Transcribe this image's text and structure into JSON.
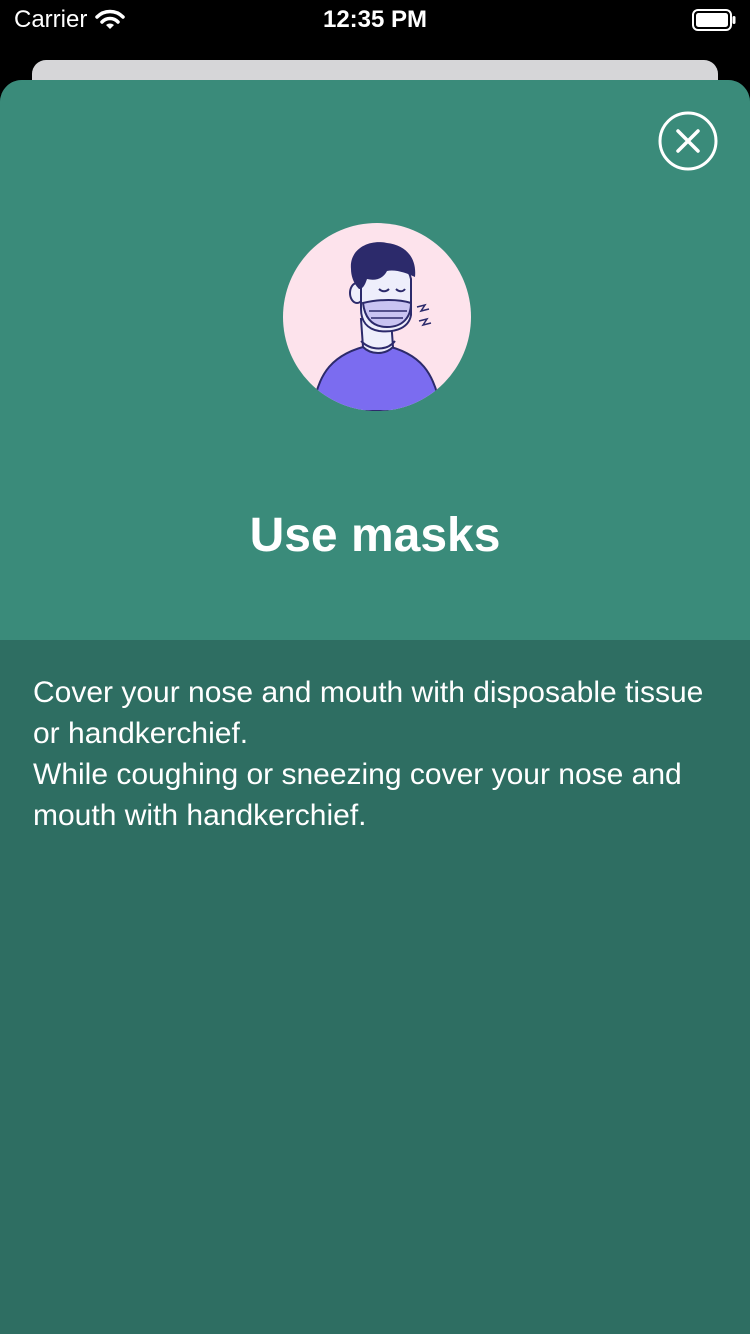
{
  "status_bar": {
    "carrier": "Carrier",
    "time": "12:35 PM",
    "wifi_icon": "wifi-icon",
    "battery_icon": "battery-icon"
  },
  "sheet": {
    "close_icon": "close-circle-icon",
    "illustration_icon": "person-wearing-mask-illustration",
    "title": "Use masks",
    "body_lines": [
      "Cover your nose and mouth with disposable tissue or handkerchief.",
      "While coughing or sneezing cover your nose and mouth with handkerchief."
    ],
    "colors": {
      "header_bg": "#3a8b7a",
      "body_bg": "#2e6e62",
      "illustration_bg": "#fde3ec",
      "shirt": "#7b6cf0"
    }
  }
}
